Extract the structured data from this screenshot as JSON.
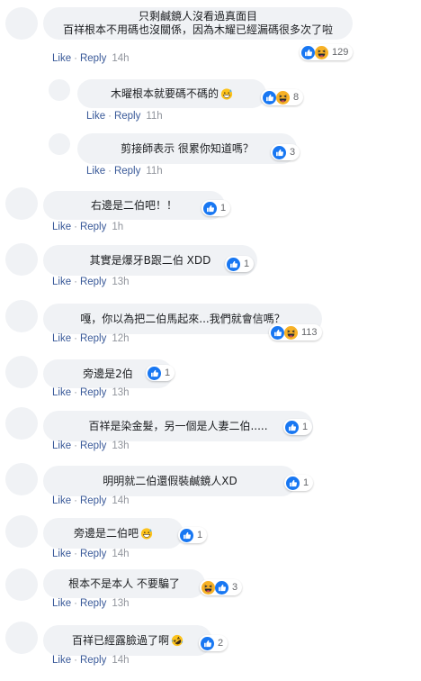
{
  "comments": [
    {
      "lines": [
        "只剩鹹鏡人沒看過真面目",
        "百祥根本不用碼也沒關係，因為木耀已經漏碼很多次了啦"
      ],
      "like_label": "Like",
      "reply_label": "Reply",
      "time": "14h",
      "reaction_count": "129",
      "reactions": [
        "like-icon",
        "haha-icon"
      ],
      "inline_emoji": ""
    },
    {
      "lines": [
        "木曜根本就要碼不碼的"
      ],
      "like_label": "Like",
      "reply_label": "Reply",
      "time": "11h",
      "reaction_count": "8",
      "reactions": [
        "like-icon",
        "haha-icon"
      ],
      "inline_emoji": "grinning-sweat-emoji"
    },
    {
      "lines": [
        "剪接師表示 很累你知道嗎？"
      ],
      "like_label": "Like",
      "reply_label": "Reply",
      "time": "11h",
      "reaction_count": "3",
      "reactions": [
        "like-icon"
      ],
      "inline_emoji": ""
    },
    {
      "lines": [
        "右邊是二伯吧！！"
      ],
      "like_label": "Like",
      "reply_label": "Reply",
      "time": "1h",
      "reaction_count": "1",
      "reactions": [
        "like-icon"
      ],
      "inline_emoji": ""
    },
    {
      "lines": [
        "其實是爆牙B跟二伯 XDD"
      ],
      "like_label": "Like",
      "reply_label": "Reply",
      "time": "13h",
      "reaction_count": "1",
      "reactions": [
        "like-icon"
      ],
      "inline_emoji": ""
    },
    {
      "lines": [
        "嘎，你以為把二伯馬起來...我們就會信嗎？"
      ],
      "like_label": "Like",
      "reply_label": "Reply",
      "time": "12h",
      "reaction_count": "113",
      "reactions": [
        "like-icon",
        "haha-icon"
      ],
      "inline_emoji": ""
    },
    {
      "lines": [
        "旁邊是2伯"
      ],
      "like_label": "Like",
      "reply_label": "Reply",
      "time": "13h",
      "reaction_count": "1",
      "reactions": [
        "like-icon"
      ],
      "inline_emoji": ""
    },
    {
      "lines": [
        "百祥是染金髮，另一個是人妻二伯....."
      ],
      "like_label": "Like",
      "reply_label": "Reply",
      "time": "13h",
      "reaction_count": "1",
      "reactions": [
        "like-icon"
      ],
      "inline_emoji": ""
    },
    {
      "lines": [
        "明明就二伯還假裝鹹鏡人XD"
      ],
      "like_label": "Like",
      "reply_label": "Reply",
      "time": "14h",
      "reaction_count": "1",
      "reactions": [
        "like-icon"
      ],
      "inline_emoji": ""
    },
    {
      "lines": [
        "旁邊是二伯吧"
      ],
      "like_label": "Like",
      "reply_label": "Reply",
      "time": "14h",
      "reaction_count": "1",
      "reactions": [
        "like-icon"
      ],
      "inline_emoji": "grinning-sweat-emoji"
    },
    {
      "lines": [
        "根本不是本人 不要騙了"
      ],
      "like_label": "Like",
      "reply_label": "Reply",
      "time": "13h",
      "reaction_count": "3",
      "reactions": [
        "haha-icon",
        "like-icon"
      ],
      "inline_emoji": ""
    },
    {
      "lines": [
        "百祥已經露臉過了啊"
      ],
      "like_label": "Like",
      "reply_label": "Reply",
      "time": "14h",
      "reaction_count": "2",
      "reactions": [
        "like-icon"
      ],
      "inline_emoji": "rofl-emoji"
    }
  ],
  "colors": {
    "bubble": "#f0f2f5",
    "link": "#385898",
    "like_blue": "#1877f2",
    "haha_yellow": "#f7b125"
  }
}
